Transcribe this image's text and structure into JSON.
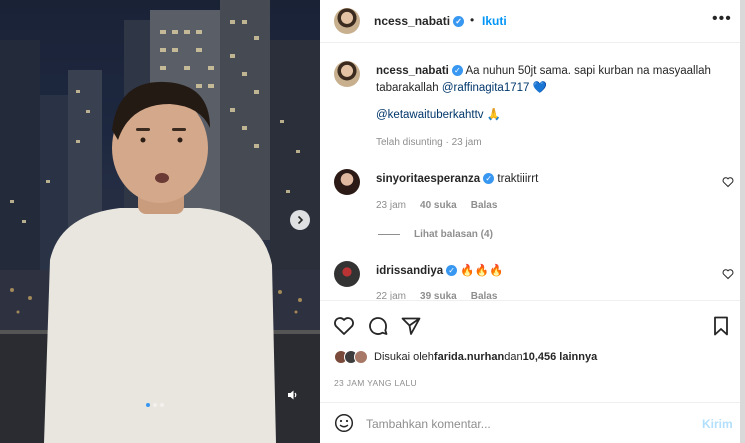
{
  "post": {
    "author": "ncess_nabati",
    "follow_label": "Ikuti",
    "more_icon": "more-horizontal-icon",
    "verified_mark": "✓",
    "separator": "•"
  },
  "caption": {
    "author": "ncess_nabati",
    "text_before": "Aa nuhun 50jt sama. sapi kurban na masyaallah tabarakallah ",
    "mention": "@raffinagita1717",
    "emoji": "💙",
    "hashtag": "@ketawaituberkahttv",
    "hashtag_emoji": "🙏",
    "edited": "Telah disunting",
    "time": "23 jam"
  },
  "comments": [
    {
      "user": "sinyoritaesperanza",
      "text": "traktiiirrt",
      "time": "23 jam",
      "likes": "40 suka",
      "reply_label": "Balas",
      "view_replies": "Lihat balasan (4)"
    },
    {
      "user": "idrissandiya",
      "text": "🔥🔥🔥",
      "time": "22 jam",
      "likes": "39 suka",
      "reply_label": "Balas"
    }
  ],
  "likes": {
    "prefix": "Disukai oleh ",
    "user": "farida.nurhan",
    "middle": " dan ",
    "count": "10,456 lainnya"
  },
  "time_ago": "23 JAM YANG LALU",
  "comment_box": {
    "placeholder": "Tambahkan komentar...",
    "post_label": "Kirim"
  },
  "media": {
    "slide_count": 3,
    "active_slide": 1
  },
  "colors": {
    "accent": "#0095f6",
    "verified": "#3897f0",
    "muted": "#8e8e8e"
  }
}
